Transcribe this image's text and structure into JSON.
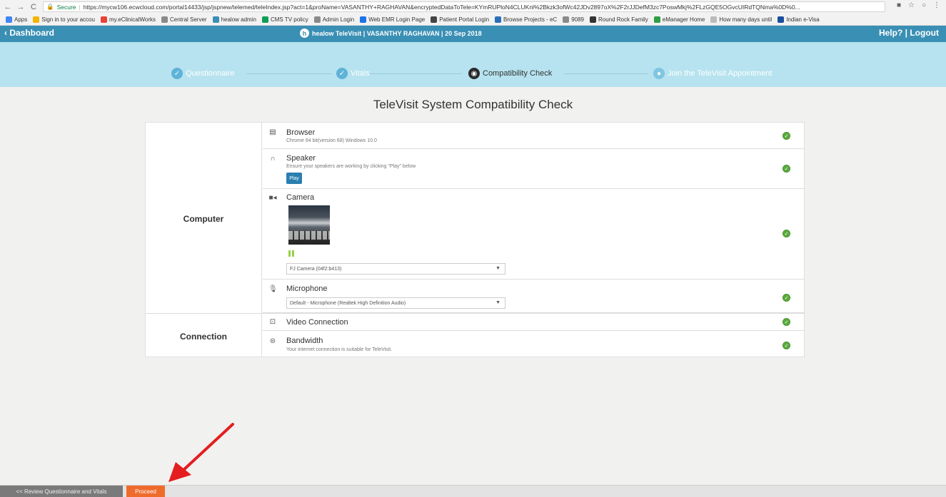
{
  "browser": {
    "secure_label": "Secure",
    "url": "https://mycw106.ecwcloud.com/portal14433/jsp/jspnew/telemed/teleIndex.jsp?act=1&proName=VASANTHY+RAGHAVAN&encryptedDataToTele=KYmRUPloN4CLUKnl%2Bkzk3ofWc42JDv2897oX%2F2rJJDefM3zc7PoswMkj%2FLzGQE5OGvcUIRdTQNma%0D%0...",
    "bookmarks": [
      {
        "label": "Apps",
        "color": "#4285f4"
      },
      {
        "label": "Sign in to your accou",
        "color": "#f4b400"
      },
      {
        "label": "my.eClinicalWorks",
        "color": "#e94235"
      },
      {
        "label": "Central Server",
        "color": "#8a8a8a"
      },
      {
        "label": "healow admin",
        "color": "#3a8fb4"
      },
      {
        "label": "CMS TV policy",
        "color": "#0f9d58"
      },
      {
        "label": "Admin Login",
        "color": "#8a8a8a"
      },
      {
        "label": "Web EMR Login Page",
        "color": "#1a73e8"
      },
      {
        "label": "Patient Portal Login",
        "color": "#444"
      },
      {
        "label": "Browse Projects - eC",
        "color": "#2a6fb8"
      },
      {
        "label": "9089",
        "color": "#8a8a8a"
      },
      {
        "label": "Round Rock Family",
        "color": "#333"
      },
      {
        "label": "eManager Home",
        "color": "#2f9e44"
      },
      {
        "label": "How many days until",
        "color": "#bbb"
      },
      {
        "label": "Indian e-Visa",
        "color": "#1a4f9c"
      }
    ]
  },
  "header": {
    "dashboard": "‹ Dashboard",
    "title": "healow TeleVisit | VASANTHY RAGHAVAN | 20 Sep 2018",
    "help": "Help?",
    "logout": "Logout"
  },
  "steps": [
    {
      "label": "Questionnaire",
      "state": "done"
    },
    {
      "label": "Vitals",
      "state": "done"
    },
    {
      "label": "Compatibility Check",
      "state": "active"
    },
    {
      "label": "Join the TeleVisit Appointment",
      "state": "future"
    }
  ],
  "main": {
    "title": "TeleVisit System Compatibility Check",
    "groups": {
      "computer": "Computer",
      "connection": "Connection"
    },
    "browser": {
      "title": "Browser",
      "sub": "Chrome 64 bit(version 68) Windows 10.0"
    },
    "speaker": {
      "title": "Speaker",
      "sub": "Ensure your speakers are working by clicking \"Play\" below",
      "play": "Play"
    },
    "camera": {
      "title": "Camera",
      "select": "FJ Camera (04f2:b413)"
    },
    "microphone": {
      "title": "Microphone",
      "select": "Default - Microphone (Realtek High Definition Audio)"
    },
    "video": {
      "title": "Video Connection"
    },
    "bandwidth": {
      "title": "Bandwidth",
      "sub": "Your internet connection is suitable for TeleVisit."
    }
  },
  "footer": {
    "review": "<< Review Questionnaire and Vitals",
    "proceed": "Proceed"
  },
  "colors": {
    "header": "#3a8fb4",
    "steps_bg": "#b6e3ef",
    "ok": "#5aab3e",
    "proceed": "#ef6b2c",
    "arrow": "#e41e1e"
  }
}
